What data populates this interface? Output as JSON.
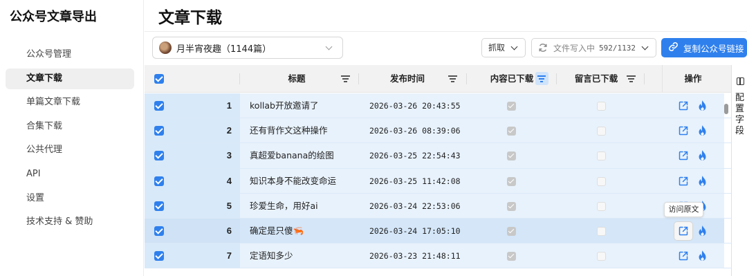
{
  "app": {
    "title": "公众号文章导出"
  },
  "sidebar": {
    "items": [
      {
        "label": "公众号管理",
        "active": false
      },
      {
        "label": "文章下载",
        "active": true
      },
      {
        "label": "单篇文章下载",
        "active": false
      },
      {
        "label": "合集下载",
        "active": false
      },
      {
        "label": "公共代理",
        "active": false
      },
      {
        "label": "API",
        "active": false
      },
      {
        "label": "设置",
        "active": false
      },
      {
        "label": "技术支持 & 赞助",
        "active": false
      }
    ]
  },
  "page": {
    "title": "文章下载"
  },
  "toolbar": {
    "account_select": "月半宵夜趣（1144篇）",
    "fetch_label": "抓取",
    "write_label": "文件写入中",
    "write_count": "592/1132",
    "copy_label": "复制公众号链接"
  },
  "table": {
    "headers": {
      "title": "标题",
      "time": "发布时间",
      "content_downloaded": "内容已下载",
      "comments_downloaded": "留言已下载",
      "actions": "操作"
    },
    "rows": [
      {
        "index": "1",
        "title": "kollab开放邀请了",
        "time": "2026-03-26 20:43:55",
        "content_downloaded": true,
        "comments_downloaded": false,
        "selected": true
      },
      {
        "index": "2",
        "title": "还有背作文这种操作",
        "time": "2026-03-26 08:39:06",
        "content_downloaded": true,
        "comments_downloaded": false,
        "selected": true
      },
      {
        "index": "3",
        "title": "真超爱banana的绘图",
        "time": "2026-03-25 22:54:43",
        "content_downloaded": true,
        "comments_downloaded": false,
        "selected": true
      },
      {
        "index": "4",
        "title": "知识本身不能改变命运",
        "time": "2026-03-25 11:42:08",
        "content_downloaded": true,
        "comments_downloaded": false,
        "selected": true
      },
      {
        "index": "5",
        "title": "珍爱生命，用好ai",
        "time": "2026-03-24 22:53:06",
        "content_downloaded": true,
        "comments_downloaded": false,
        "selected": true
      },
      {
        "index": "6",
        "title": "确定是只傻🦐",
        "time": "2026-03-24 17:05:10",
        "content_downloaded": true,
        "comments_downloaded": false,
        "selected": true
      },
      {
        "index": "7",
        "title": "定语知多少",
        "time": "2026-03-23 21:48:11",
        "content_downloaded": true,
        "comments_downloaded": false,
        "selected": true
      }
    ]
  },
  "tooltip": "访问原文",
  "side_panel": {
    "label": "配置字段"
  },
  "colors": {
    "accent": "#2f80ed",
    "row_bg": "#e8f2fc"
  }
}
